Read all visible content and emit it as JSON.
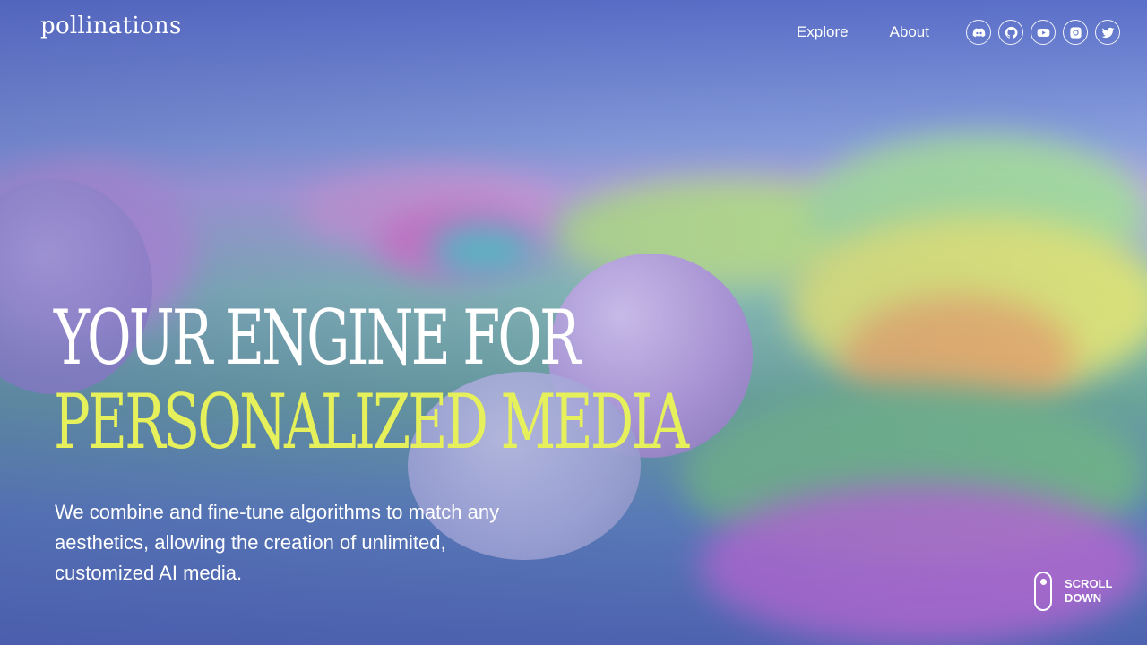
{
  "brand": {
    "logo_text": "pollinations"
  },
  "nav": {
    "links": [
      "Explore",
      "About"
    ]
  },
  "social": [
    {
      "name": "discord-icon"
    },
    {
      "name": "github-icon"
    },
    {
      "name": "youtube-icon"
    },
    {
      "name": "instagram-icon"
    },
    {
      "name": "twitter-icon"
    }
  ],
  "hero": {
    "headline_line1": "YOUR ENGINE FOR",
    "headline_line2": "PERSONALIZED MEDIA",
    "tagline": "We combine and fine-tune algorithms to match any aesthetics, allowing the creation of unlimited, customized AI media."
  },
  "scroll": {
    "label_line1": "SCROLL",
    "label_line2": "DOWN"
  },
  "colors": {
    "accent": "#e6f05a",
    "text": "#ffffff"
  }
}
